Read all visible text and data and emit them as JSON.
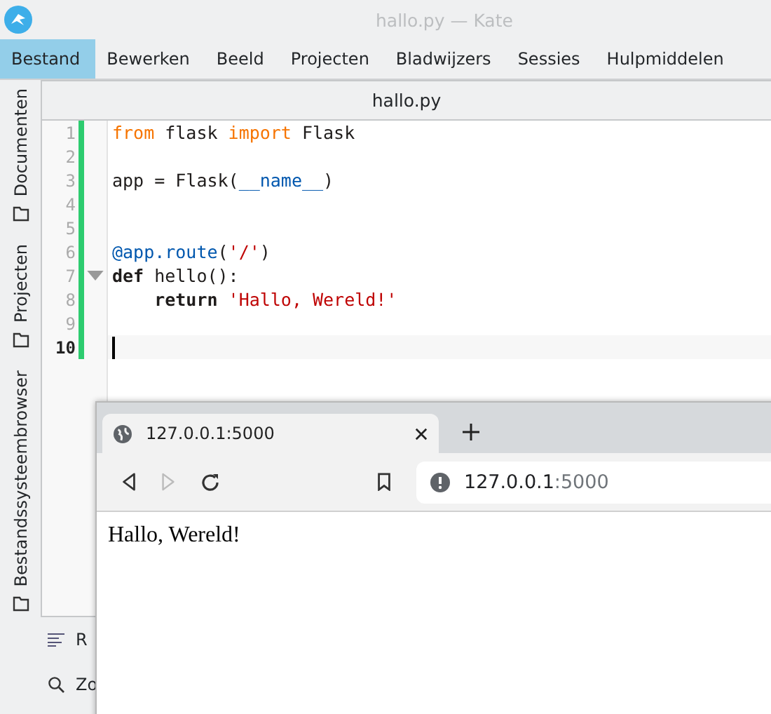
{
  "window": {
    "title": "hallo.py — Kate"
  },
  "menu": [
    {
      "label": "Bestand",
      "selected": true
    },
    {
      "label": "Bewerken",
      "selected": false
    },
    {
      "label": "Beeld",
      "selected": false
    },
    {
      "label": "Projecten",
      "selected": false
    },
    {
      "label": "Bladwijzers",
      "selected": false
    },
    {
      "label": "Sessies",
      "selected": false
    },
    {
      "label": "Hulpmiddelen",
      "selected": false
    }
  ],
  "sidebar_tabs": [
    {
      "label": "Documenten"
    },
    {
      "label": "Projecten"
    },
    {
      "label": "Bestandssysteembrowser"
    }
  ],
  "editor": {
    "tab": "hallo.py",
    "lines": [
      {
        "number": "1",
        "current": false,
        "foldable": false,
        "tokens": [
          {
            "text": "from",
            "kind": "keyword"
          },
          {
            "text": " flask ",
            "kind": "plain"
          },
          {
            "text": "import",
            "kind": "keyword"
          },
          {
            "text": " Flask",
            "kind": "plain"
          }
        ]
      },
      {
        "number": "2",
        "current": false,
        "foldable": false
      },
      {
        "number": "3",
        "current": false,
        "foldable": false,
        "tokens": [
          {
            "text": "app = Flask(",
            "kind": "plain"
          },
          {
            "text": "__name__",
            "kind": "builtin"
          },
          {
            "text": ")",
            "kind": "plain"
          }
        ]
      },
      {
        "number": "4",
        "current": false,
        "foldable": false
      },
      {
        "number": "5",
        "current": false,
        "foldable": false
      },
      {
        "number": "6",
        "current": false,
        "foldable": false,
        "tokens": [
          {
            "text": "@app.route",
            "kind": "decorator"
          },
          {
            "text": "(",
            "kind": "plain"
          },
          {
            "text": "'/'",
            "kind": "string"
          },
          {
            "text": ")",
            "kind": "plain"
          }
        ]
      },
      {
        "number": "7",
        "current": false,
        "foldable": true,
        "tokens": [
          {
            "text": "def",
            "kind": "bold"
          },
          {
            "text": " hello():",
            "kind": "plain"
          }
        ]
      },
      {
        "number": "8",
        "current": false,
        "foldable": false,
        "tokens": [
          {
            "text": "    return",
            "kind": "bold"
          },
          {
            "text": " 'Hallo, Wereld!'",
            "kind": "string"
          }
        ]
      },
      {
        "number": "9",
        "current": false,
        "foldable": false
      },
      {
        "number": "10",
        "current": true,
        "foldable": false
      }
    ]
  },
  "bottom_tools": [
    {
      "label": "R",
      "kind": "outline"
    },
    {
      "label": "Zo",
      "kind": "search"
    }
  ],
  "browser": {
    "tab": {
      "title": "127.0.0.1:5000"
    },
    "address": {
      "host": "127.0.0.1",
      "port": ":5000"
    },
    "content": "Hallo, Wereld!"
  }
}
